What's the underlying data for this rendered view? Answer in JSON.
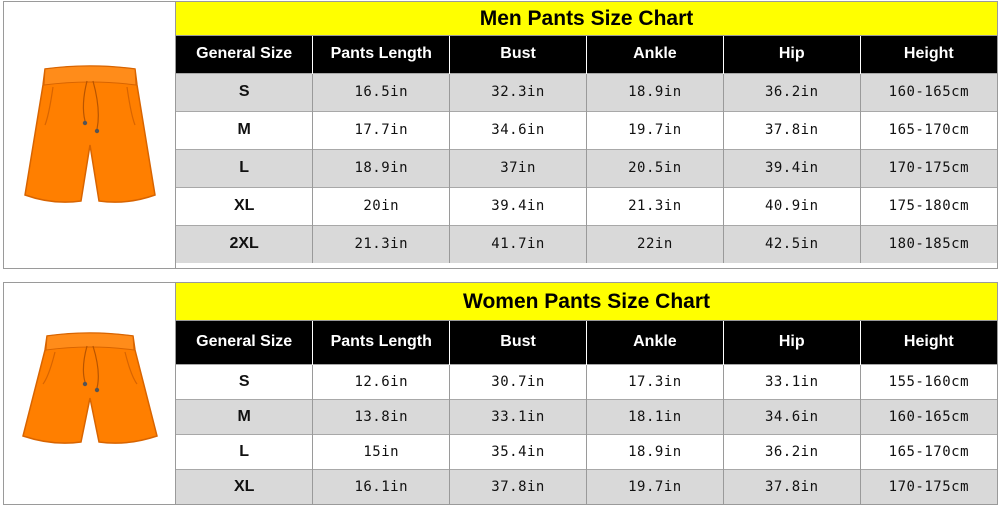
{
  "colors": {
    "title_bg": "#ffff00",
    "header_bg": "#000000",
    "header_text": "#ffffff",
    "alt_row_bg": "#d9d9d9",
    "garment": "#ff7f00"
  },
  "men": {
    "title": "Men Pants Size Chart",
    "image_icon": "orange-shorts-icon",
    "headers": [
      "General Size",
      "Pants Length",
      "Bust",
      "Ankle",
      "Hip",
      "Height"
    ],
    "rows": [
      [
        "S",
        "16.5in",
        "32.3in",
        "18.9in",
        "36.2in",
        "160-165cm"
      ],
      [
        "M",
        "17.7in",
        "34.6in",
        "19.7in",
        "37.8in",
        "165-170cm"
      ],
      [
        "L",
        "18.9in",
        "37in",
        "20.5in",
        "39.4in",
        "170-175cm"
      ],
      [
        "XL",
        "20in",
        "39.4in",
        "21.3in",
        "40.9in",
        "175-180cm"
      ],
      [
        "2XL",
        "21.3in",
        "41.7in",
        "22in",
        "42.5in",
        "180-185cm"
      ]
    ]
  },
  "women": {
    "title": "Women Pants Size Chart",
    "image_icon": "orange-shorts-icon",
    "headers": [
      "General Size",
      "Pants Length",
      "Bust",
      "Ankle",
      "Hip",
      "Height"
    ],
    "rows": [
      [
        "S",
        "12.6in",
        "30.7in",
        "17.3in",
        "33.1in",
        "155-160cm"
      ],
      [
        "M",
        "13.8in",
        "33.1in",
        "18.1in",
        "34.6in",
        "160-165cm"
      ],
      [
        "L",
        "15in",
        "35.4in",
        "18.9in",
        "36.2in",
        "165-170cm"
      ],
      [
        "XL",
        "16.1in",
        "37.8in",
        "19.7in",
        "37.8in",
        "170-175cm"
      ]
    ]
  }
}
